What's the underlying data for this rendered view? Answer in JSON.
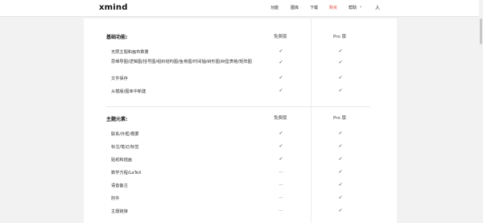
{
  "header": {
    "logo": "xmind",
    "nav": [
      {
        "label": "功能"
      },
      {
        "label": "图库"
      },
      {
        "label": "下载"
      },
      {
        "label": "购买"
      },
      {
        "label": "帮助"
      }
    ],
    "user_icon_char": "人"
  },
  "sections": [
    {
      "title": "基础功能:",
      "col_free": "免费版",
      "col_pro": "Pro 版",
      "rows": [
        {
          "label": "无限主题和画布数量",
          "free": "✓",
          "pro": "✓"
        },
        {
          "label": "思维导图/逻辑图/括号图/组织结构图/鱼骨图/时间轴/树形图/树型表格/矩阵图",
          "free": "✓",
          "pro": "✓"
        },
        {
          "label": "文件保存",
          "free": "✓",
          "pro": "✓"
        },
        {
          "label": "从模版/图库中新建",
          "free": "✓",
          "pro": "✓"
        }
      ]
    },
    {
      "title": "主题元素:",
      "col_free": "免费版",
      "col_pro": "Pro 版",
      "rows": [
        {
          "label": "联系/外框/概要",
          "free": "✓",
          "pro": "✓"
        },
        {
          "label": "标注/笔记/标签",
          "free": "✓",
          "pro": "✓"
        },
        {
          "label": "贴纸和插画",
          "free": "✓",
          "pro": "✓"
        },
        {
          "label": "数学方程/LaTeX",
          "free": "—",
          "pro": "✓"
        },
        {
          "label": "语音备注",
          "free": "—",
          "pro": "✓"
        },
        {
          "label": "附件",
          "free": "—",
          "pro": "✓"
        },
        {
          "label": "主题链接",
          "free": "—",
          "pro": "✓"
        }
      ]
    }
  ],
  "colors": {
    "accent": "#e0463c",
    "background": "#f2f2f2",
    "card": "#ffffff"
  }
}
